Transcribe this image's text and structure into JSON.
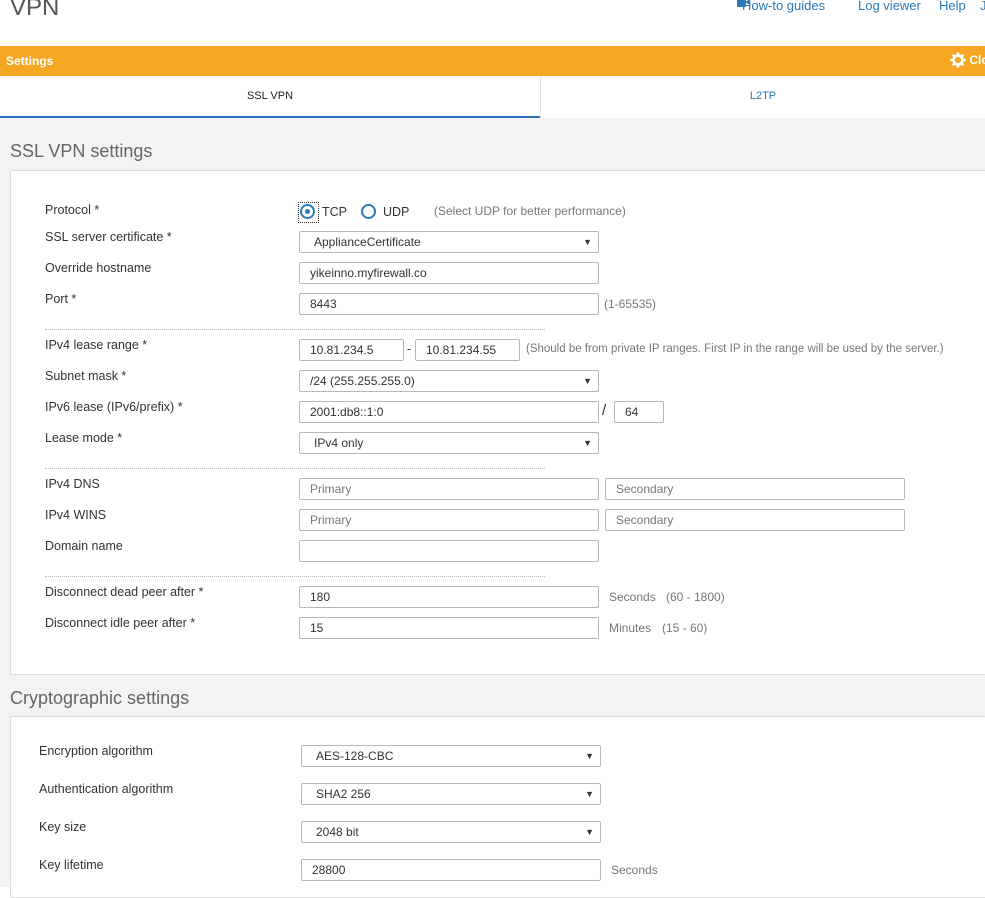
{
  "header": {
    "title": "VPN",
    "links": {
      "howto": "How-to guides",
      "logviewer": "Log viewer",
      "help": "Help",
      "more": "J"
    }
  },
  "bar": {
    "label": "Settings",
    "close_label": "Clo"
  },
  "tabs": {
    "ssl": "SSL VPN",
    "l2tp": "L2TP"
  },
  "ssl_section": {
    "title": "SSL VPN settings",
    "protocol": {
      "label": "Protocol *",
      "tcp": "TCP",
      "udp": "UDP",
      "hint": "(Select UDP for better performance)",
      "selected": "TCP"
    },
    "cert": {
      "label": "SSL server certificate *",
      "value": "ApplianceCertificate"
    },
    "hostname": {
      "label": "Override hostname",
      "value": "yikeinno.myfirewall.co"
    },
    "port": {
      "label": "Port *",
      "value": "8443",
      "hint": "(1-65535)"
    },
    "ipv4_range": {
      "label": "IPv4 lease range *",
      "start": "10.81.234.5",
      "dash": "-",
      "end": "10.81.234.55",
      "hint": "(Should be from private IP ranges. First IP in the range will be used by the server.)"
    },
    "subnet": {
      "label": "Subnet mask *",
      "value": "/24 (255.255.255.0)"
    },
    "ipv6": {
      "label": "IPv6 lease (IPv6/prefix) *",
      "value": "2001:db8::1:0",
      "slash": "/",
      "prefix": "64"
    },
    "lease_mode": {
      "label": "Lease mode *",
      "value": "IPv4 only"
    },
    "dns": {
      "label": "IPv4 DNS",
      "primary_ph": "Primary",
      "secondary_ph": "Secondary"
    },
    "wins": {
      "label": "IPv4 WINS",
      "primary_ph": "Primary",
      "secondary_ph": "Secondary"
    },
    "domain": {
      "label": "Domain name",
      "value": ""
    },
    "dead_peer": {
      "label": "Disconnect dead peer after *",
      "value": "180",
      "unit": "Seconds",
      "range": "(60 - 1800)"
    },
    "idle_peer": {
      "label": "Disconnect idle peer after *",
      "value": "15",
      "unit": "Minutes",
      "range": "(15 - 60)"
    }
  },
  "crypto_section": {
    "title": "Cryptographic settings",
    "encryption": {
      "label": "Encryption algorithm",
      "value": "AES-128-CBC"
    },
    "auth": {
      "label": "Authentication algorithm",
      "value": "SHA2 256"
    },
    "keysize": {
      "label": "Key size",
      "value": "2048 bit"
    },
    "lifetime": {
      "label": "Key lifetime",
      "value": "28800",
      "unit": "Seconds"
    }
  },
  "colors": {
    "accent": "#f5a623",
    "link": "#2a7ab8",
    "tab_underline": "#2a6ebb"
  },
  "icons": {
    "video": "video-camera-icon",
    "gear": "gear-icon",
    "caret": "caret-down-icon"
  }
}
